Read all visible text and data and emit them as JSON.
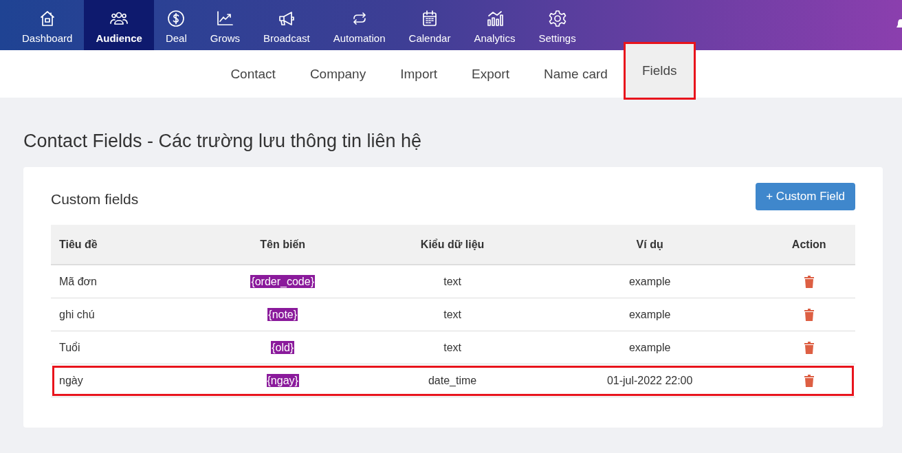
{
  "nav": [
    {
      "label": "Dashboard",
      "selected": false
    },
    {
      "label": "Audience",
      "selected": true
    },
    {
      "label": "Deal",
      "selected": false
    },
    {
      "label": "Grows",
      "selected": false
    },
    {
      "label": "Broadcast",
      "selected": false
    },
    {
      "label": "Automation",
      "selected": false
    },
    {
      "label": "Calendar",
      "selected": false
    },
    {
      "label": "Analytics",
      "selected": false
    },
    {
      "label": "Settings",
      "selected": false
    }
  ],
  "subtabs": [
    {
      "label": "Contact",
      "selected": false,
      "highlighted": false
    },
    {
      "label": "Company",
      "selected": false,
      "highlighted": false
    },
    {
      "label": "Import",
      "selected": false,
      "highlighted": false
    },
    {
      "label": "Export",
      "selected": false,
      "highlighted": false
    },
    {
      "label": "Name card",
      "selected": false,
      "highlighted": false
    },
    {
      "label": "Fields",
      "selected": true,
      "highlighted": true
    }
  ],
  "page_title": "Contact Fields - Các trường lưu thông tin liên hệ",
  "card": {
    "title": "Custom fields",
    "add_button": "+ Custom Field"
  },
  "table": {
    "columns": [
      "Tiêu đề",
      "Tên biến",
      "Kiểu dữ liệu",
      "Ví dụ",
      "Action"
    ],
    "rows": [
      {
        "title": "Mã đơn",
        "variable": "{order_code}",
        "type": "text",
        "example": "example",
        "highlighted": false
      },
      {
        "title": "ghi chú",
        "variable": "{note}",
        "type": "text",
        "example": "example",
        "highlighted": false
      },
      {
        "title": "Tuổi",
        "variable": "{old}",
        "type": "text",
        "example": "example",
        "highlighted": false
      },
      {
        "title": "ngày",
        "variable": "{ngay}",
        "type": "date_time",
        "example": "01-jul-2022 22:00",
        "highlighted": true
      }
    ]
  }
}
